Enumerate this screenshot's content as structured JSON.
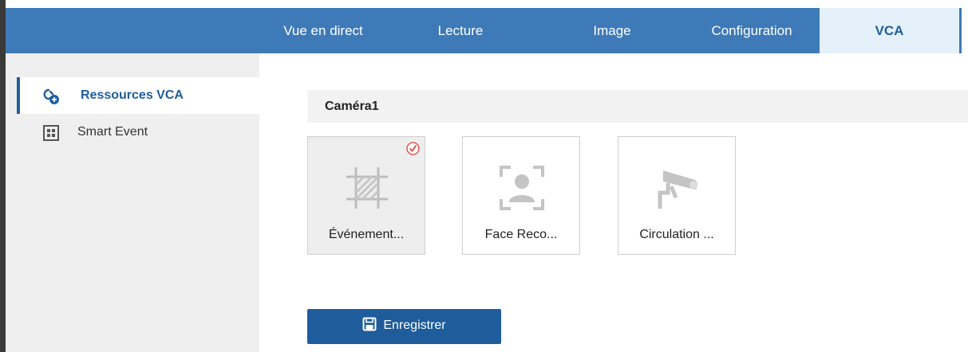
{
  "nav": {
    "tabs": [
      {
        "label": "Vue en direct"
      },
      {
        "label": "Lecture"
      },
      {
        "label": "Image"
      },
      {
        "label": "Configuration"
      },
      {
        "label": "VCA"
      }
    ],
    "active": "VCA"
  },
  "sidebar": {
    "items": [
      {
        "label": "Ressources VCA",
        "icon": "vca-resource-icon",
        "active": true
      },
      {
        "label": "Smart Event",
        "icon": "smart-event-icon",
        "active": false
      }
    ]
  },
  "main": {
    "camera_title": "Caméra1",
    "cards": [
      {
        "label": "Événement...",
        "icon": "event-region-icon",
        "selected": true
      },
      {
        "label": "Face Reco...",
        "icon": "face-recognition-icon",
        "selected": false
      },
      {
        "label": "Circulation ...",
        "icon": "traffic-camera-icon",
        "selected": false
      }
    ],
    "save_label": "Enregistrer"
  },
  "colors": {
    "topbar": "#3e7ab8",
    "active_tab_bg": "#e4f1fb",
    "accent": "#1e5c9b",
    "check": "#e53935"
  }
}
